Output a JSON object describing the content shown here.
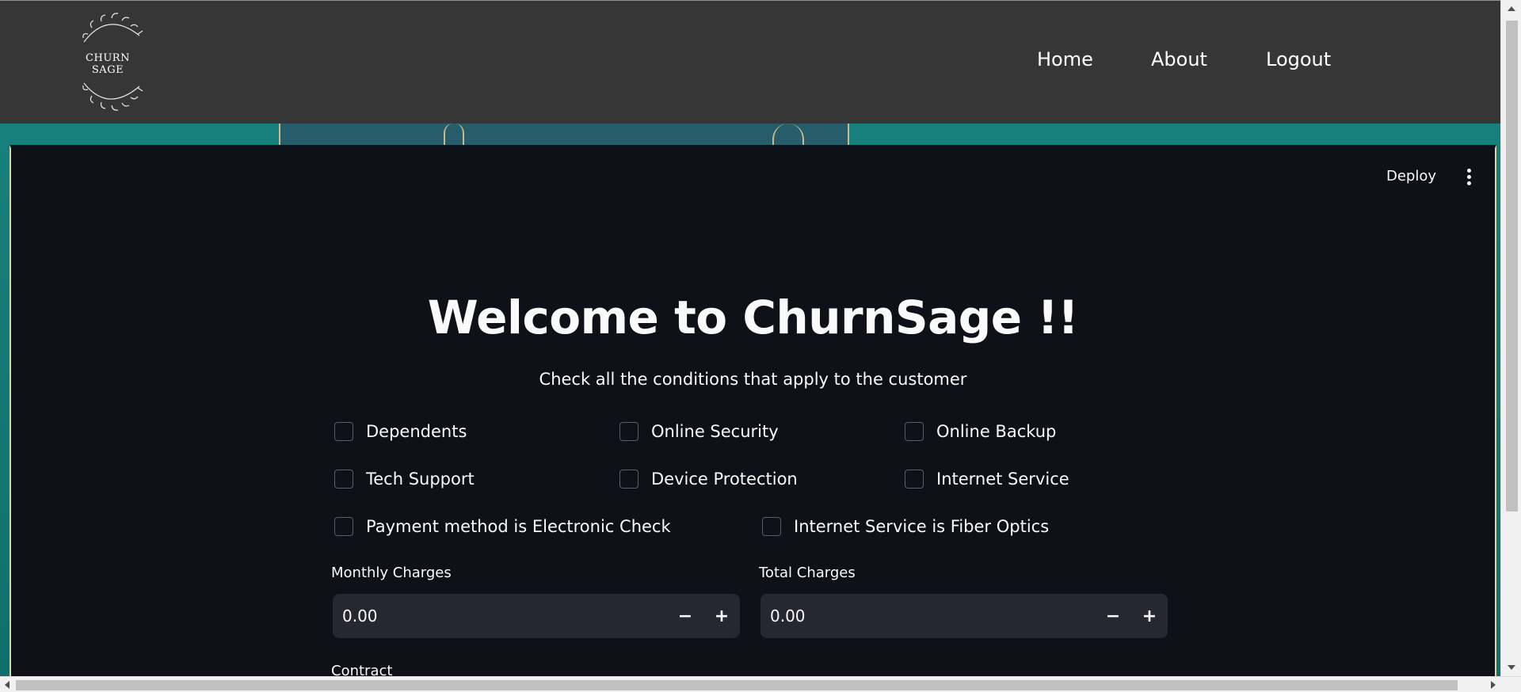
{
  "nav": {
    "logo_text": "CHURN SAGE",
    "links": [
      "Home",
      "About",
      "Logout"
    ]
  },
  "app": {
    "deploy_label": "Deploy",
    "title": "Welcome to ChurnSage !!",
    "subtitle": "Check all the conditions that apply to the customer",
    "checkboxes": [
      {
        "label": "Dependents",
        "checked": false
      },
      {
        "label": "Online Security",
        "checked": false
      },
      {
        "label": "Online Backup",
        "checked": false
      },
      {
        "label": "Tech Support",
        "checked": false
      },
      {
        "label": "Device Protection",
        "checked": false
      },
      {
        "label": "Internet Service",
        "checked": false
      },
      {
        "label": "Payment method is Electronic Check",
        "checked": false
      },
      {
        "label": "Internet Service is Fiber Optics",
        "checked": false
      }
    ],
    "monthly_charges": {
      "label": "Monthly Charges",
      "value": "0.00"
    },
    "total_charges": {
      "label": "Total Charges",
      "value": "0.00"
    },
    "stepper": {
      "minus": "−",
      "plus": "+"
    },
    "contract_label": "Contract"
  },
  "colors": {
    "navbar": "#363636",
    "app_background": "#0e1117",
    "input_background": "#262730",
    "backdrop": "#18807c",
    "accent_start": "#ff4b4b",
    "accent_end": "#fdfd96"
  }
}
